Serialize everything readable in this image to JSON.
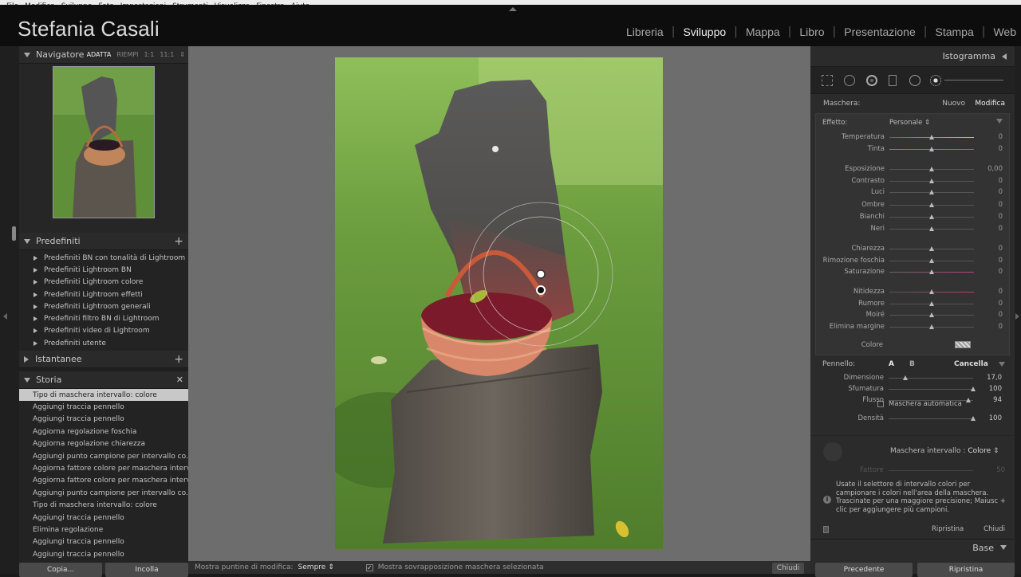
{
  "menubar": [
    "File",
    "Modifica",
    "Sviluppo",
    "Foto",
    "Impostazioni",
    "Strumenti",
    "Visualizza",
    "Finestra",
    "Aiuto"
  ],
  "identity_plate": "Stefania Casali",
  "modules": [
    {
      "label": "Libreria",
      "active": false
    },
    {
      "label": "Sviluppo",
      "active": true
    },
    {
      "label": "Mappa",
      "active": false
    },
    {
      "label": "Libro",
      "active": false
    },
    {
      "label": "Presentazione",
      "active": false
    },
    {
      "label": "Stampa",
      "active": false
    },
    {
      "label": "Web",
      "active": false
    }
  ],
  "navigator": {
    "title": "Navigatore",
    "fit": "ADATTA",
    "fill": "RIEMPI",
    "z1": "1:1",
    "z2": "11:1"
  },
  "presets": {
    "title": "Predefiniti",
    "items": [
      "Predefiniti BN con tonalità di Lightroom",
      "Predefiniti Lightroom BN",
      "Predefiniti Lightroom colore",
      "Predefiniti Lightroom effetti",
      "Predefiniti Lightroom generali",
      "Predefiniti filtro BN di Lightroom",
      "Predefiniti video di Lightroom",
      "Predefiniti utente"
    ]
  },
  "snapshots": {
    "title": "Istantanee"
  },
  "history": {
    "title": "Storia",
    "items": [
      "Tipo di maschera intervallo: colore",
      "Aggiungi traccia pennello",
      "Aggiungi traccia pennello",
      "Aggiorna regolazione foschia",
      "Aggiorna regolazione chiarezza",
      "Aggiungi punto campione per intervallo co...",
      "Aggiorna fattore colore per maschera interv...",
      "Aggiorna fattore colore per maschera interv...",
      "Aggiungi punto campione per intervallo co...",
      "Tipo di maschera intervallo: colore",
      "Aggiungi traccia pennello",
      "Elimina regolazione",
      "Aggiungi traccia pennello",
      "Aggiungi traccia pennello",
      "Aggiungi traccia pennello"
    ],
    "selected_index": 0
  },
  "left_buttons": {
    "copy": "Copia...",
    "paste": "Incolla"
  },
  "toolbar": {
    "pins_label": "Mostra puntine di modifica:",
    "pins_value": "Sempre",
    "overlay_label": "Mostra sovrapposizione maschera selezionata",
    "close": "Chiudi"
  },
  "right": {
    "histogram_title": "Istogramma",
    "mask_label": "Maschera:",
    "mask_new": "Nuovo",
    "mask_edit": "Modifica",
    "effect_label": "Effetto:",
    "effect_value": "Personale",
    "sliders": [
      {
        "label": "Temperatura",
        "value": "0",
        "pos": 0.5
      },
      {
        "label": "Tinta",
        "value": "0",
        "pos": 0.5
      },
      {
        "label": "Esposizione",
        "value": "0,00",
        "pos": 0.5
      },
      {
        "label": "Contrasto",
        "value": "0",
        "pos": 0.5
      },
      {
        "label": "Luci",
        "value": "0",
        "pos": 0.5
      },
      {
        "label": "Ombre",
        "value": "0",
        "pos": 0.5
      },
      {
        "label": "Bianchi",
        "value": "0",
        "pos": 0.5
      },
      {
        "label": "Neri",
        "value": "0",
        "pos": 0.5
      },
      {
        "label": "Chiarezza",
        "value": "0",
        "pos": 0.5
      },
      {
        "label": "Rimozione foschia",
        "value": "0",
        "pos": 0.5
      },
      {
        "label": "Saturazione",
        "value": "0",
        "pos": 0.5
      },
      {
        "label": "Nitidezza",
        "value": "0",
        "pos": 0.5
      },
      {
        "label": "Rumore",
        "value": "0",
        "pos": 0.5
      },
      {
        "label": "Moiré",
        "value": "0",
        "pos": 0.5
      },
      {
        "label": "Elimina margine",
        "value": "0",
        "pos": 0.5
      }
    ],
    "color_label": "Colore",
    "brush": {
      "label": "Pennello:",
      "a": "A",
      "b": "B",
      "erase": "Cancella",
      "size_label": "Dimensione",
      "size_value": "17,0",
      "size_pos": 0.2,
      "feather_label": "Sfumatura",
      "feather_value": "100",
      "feather_pos": 1.0,
      "flow_label": "Flusso",
      "flow_value": "94",
      "flow_pos": 0.94,
      "auto_mask": "Maschera automatica",
      "density_label": "Densità",
      "density_value": "100",
      "density_pos": 1.0
    },
    "range_mask": {
      "label": "Maschera intervallo :",
      "value": "Colore",
      "amount_label": "Fattore",
      "amount_value": "50",
      "info": "Usate il selettore di intervallo colori per campionare i colori nell'area della maschera. Trascinate per una maggiore precisione; Maiusc + clic per aggiungere più campioni.",
      "reset": "Ripristina",
      "close": "Chiudi"
    },
    "base": "Base",
    "prev": "Precedente",
    "reset_all": "Ripristina"
  }
}
